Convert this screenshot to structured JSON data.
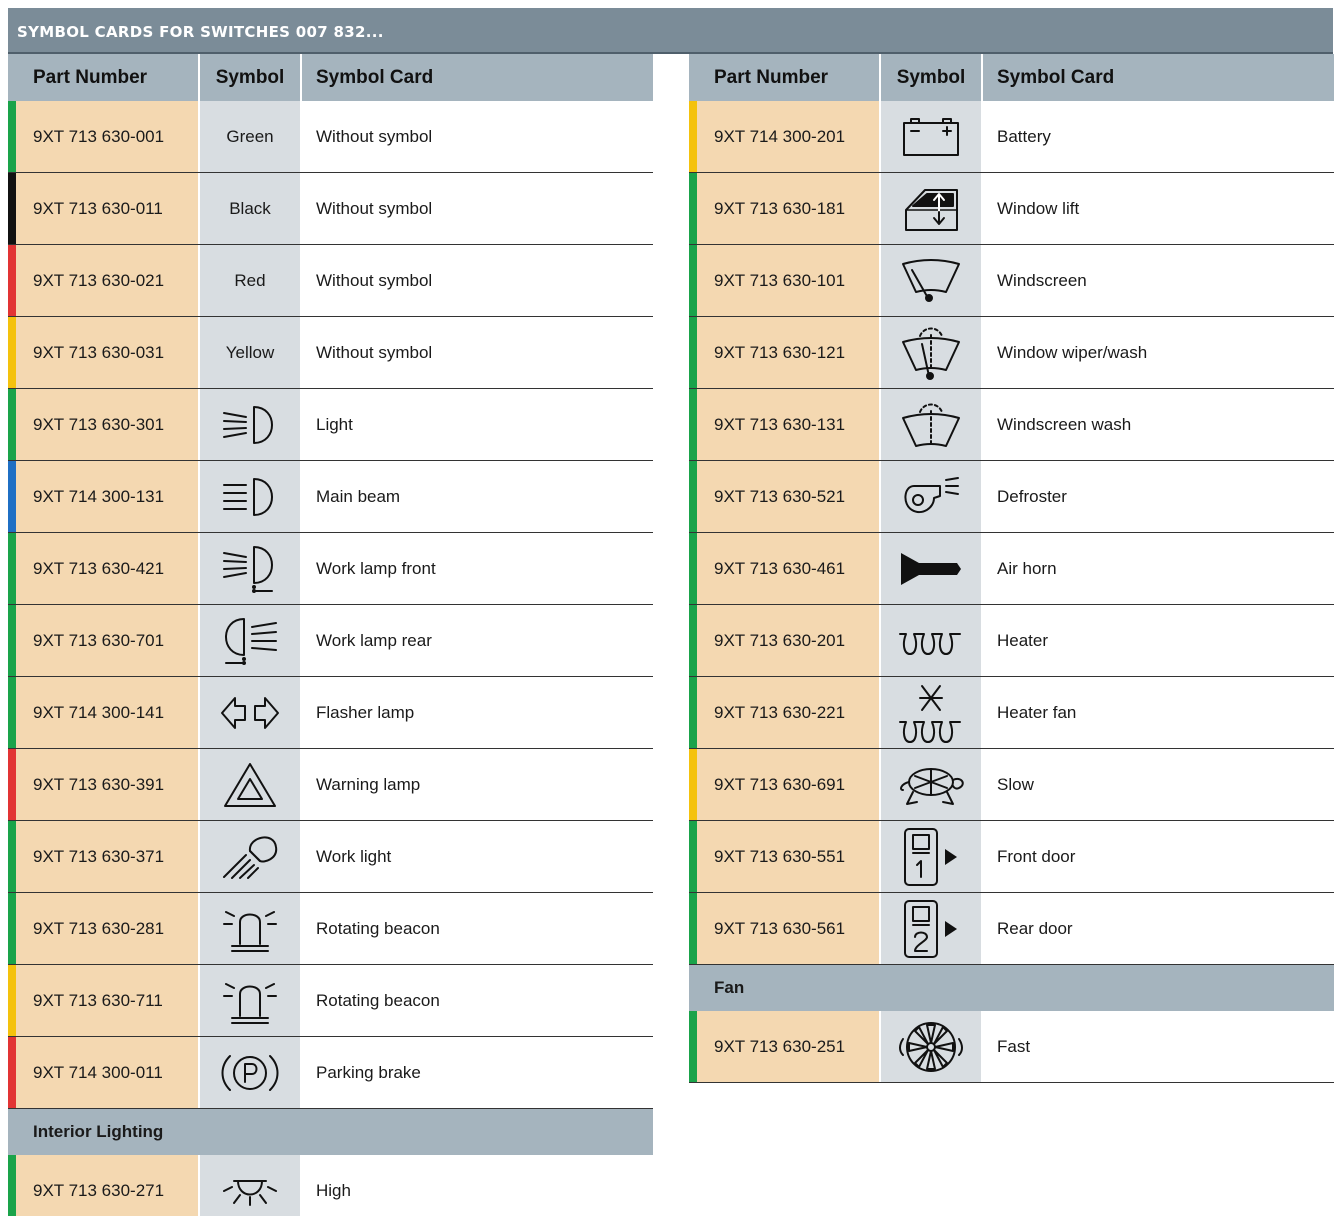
{
  "title": "SYMBOL CARDS FOR SWITCHES 007 832...",
  "columns": {
    "part": "Part Number",
    "symbol": "Symbol",
    "card": "Symbol Card"
  },
  "colors": {
    "green": "#1aa34a",
    "black": "#111111",
    "red": "#e23434",
    "yellow": "#f4c20d",
    "blue": "#1f6fc4"
  },
  "left_rows": [
    {
      "part": "9XT 713 630-001",
      "symbol_text": "Green",
      "card": "Without symbol",
      "bar": "green"
    },
    {
      "part": "9XT 713 630-011",
      "symbol_text": "Black",
      "card": "Without symbol",
      "bar": "black"
    },
    {
      "part": "9XT 713 630-021",
      "symbol_text": "Red",
      "card": "Without symbol",
      "bar": "red"
    },
    {
      "part": "9XT 713 630-031",
      "symbol_text": "Yellow",
      "card": "Without symbol",
      "bar": "yellow"
    },
    {
      "part": "9XT 713 630-301",
      "icon": "light-icon",
      "card": "Light",
      "bar": "green"
    },
    {
      "part": "9XT 714 300-131",
      "icon": "main-beam-icon",
      "card": "Main beam",
      "bar": "blue"
    },
    {
      "part": "9XT 713 630-421",
      "icon": "work-lamp-front-icon",
      "card": "Work lamp front",
      "bar": "green"
    },
    {
      "part": "9XT 713 630-701",
      "icon": "work-lamp-rear-icon",
      "card": "Work lamp rear",
      "bar": "green"
    },
    {
      "part": "9XT 714 300-141",
      "icon": "flasher-lamp-icon",
      "card": "Flasher lamp",
      "bar": "green"
    },
    {
      "part": "9XT 713 630-391",
      "icon": "warning-lamp-icon",
      "card": "Warning lamp",
      "bar": "red"
    },
    {
      "part": "9XT 713 630-371",
      "icon": "work-light-icon",
      "card": "Work light",
      "bar": "green"
    },
    {
      "part": "9XT 713 630-281",
      "icon": "rotating-beacon-icon",
      "card": "Rotating beacon",
      "bar": "green"
    },
    {
      "part": "9XT 713 630-711",
      "icon": "rotating-beacon-icon",
      "card": "Rotating beacon",
      "bar": "yellow"
    },
    {
      "part": "9XT 714 300-011",
      "icon": "parking-brake-icon",
      "card": "Parking brake",
      "bar": "red"
    }
  ],
  "left_section": "Interior Lighting",
  "left_section_rows": [
    {
      "part": "9XT 713 630-271",
      "icon": "interior-light-high-icon",
      "card": "High",
      "bar": "green"
    }
  ],
  "right_rows": [
    {
      "part": "9XT 714 300-201",
      "icon": "battery-icon",
      "card": "Battery",
      "bar": "yellow"
    },
    {
      "part": "9XT 713 630-181",
      "icon": "window-lift-icon",
      "card": "Window lift",
      "bar": "green"
    },
    {
      "part": "9XT 713 630-101",
      "icon": "windscreen-icon",
      "card": "Windscreen",
      "bar": "green"
    },
    {
      "part": "9XT 713 630-121",
      "icon": "window-wiper-wash-icon",
      "card": "Window wiper/wash",
      "bar": "green"
    },
    {
      "part": "9XT 713 630-131",
      "icon": "windscreen-wash-icon",
      "card": "Windscreen wash",
      "bar": "green"
    },
    {
      "part": "9XT 713 630-521",
      "icon": "defroster-icon",
      "card": "Defroster",
      "bar": "green"
    },
    {
      "part": "9XT 713 630-461",
      "icon": "air-horn-icon",
      "card": "Air horn",
      "bar": "green"
    },
    {
      "part": "9XT 713 630-201",
      "icon": "heater-icon",
      "card": "Heater",
      "bar": "green"
    },
    {
      "part": "9XT 713 630-221",
      "icon": "heater-fan-icon",
      "card": "Heater fan",
      "bar": "green"
    },
    {
      "part": "9XT 713 630-691",
      "icon": "slow-turtle-icon",
      "card": "Slow",
      "bar": "yellow"
    },
    {
      "part": "9XT 713 630-551",
      "icon": "front-door-icon",
      "door_digit": "1",
      "card": "Front door",
      "bar": "green"
    },
    {
      "part": "9XT 713 630-561",
      "icon": "rear-door-icon",
      "door_digit": "2",
      "card": "Rear door",
      "bar": "green"
    }
  ],
  "right_section": "Fan",
  "right_section_rows": [
    {
      "part": "9XT 713 630-251",
      "icon": "fan-fast-icon",
      "card": "Fast",
      "bar": "green"
    }
  ]
}
